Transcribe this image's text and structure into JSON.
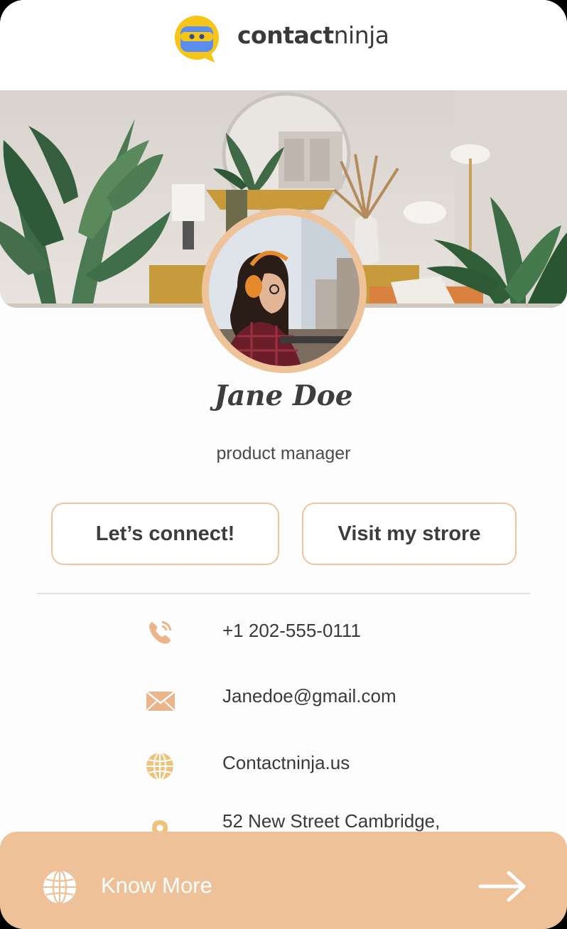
{
  "brand": {
    "name_bold": "contact",
    "name_light": "ninja",
    "colors": {
      "logo_yellow": "#f5c518",
      "logo_blue": "#5b8def",
      "accent_peach": "#eec199",
      "icon_peach": "#eab58a"
    }
  },
  "profile": {
    "name": "Jane Doe",
    "role": "product manager"
  },
  "actions": {
    "connect_label": "Let’s connect!",
    "store_label": "Visit my strore"
  },
  "contact": {
    "phone": "+1 202-555-0111",
    "email": "Janedoe@gmail.com",
    "website": "Contactninja.us",
    "address": "52 New Street Cambridge,"
  },
  "icons": {
    "phone": "phone-icon",
    "email": "envelope-icon",
    "website": "globe-icon",
    "address": "location-pin-icon",
    "footer_left": "globe-icon",
    "footer_right": "arrow-right-icon"
  },
  "footer": {
    "label": "Know More"
  }
}
